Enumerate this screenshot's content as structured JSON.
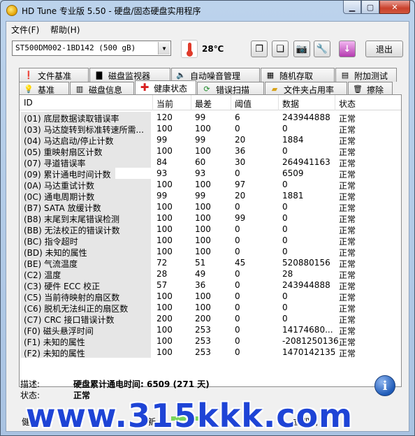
{
  "window": {
    "title": "HD Tune 专业版 5.50 - 硬盘/固态硬盘实用程序"
  },
  "menu": [
    {
      "label": "文件(F)"
    },
    {
      "label": "帮助(H)"
    }
  ],
  "toolbar": {
    "drive": "ST500DM002-1BD142 (500 gB)",
    "temperature": "28℃",
    "exit_label": "退出"
  },
  "tabs_top": [
    {
      "label": "文件基准",
      "icon": "file-benchmark-icon"
    },
    {
      "label": "磁盘监视器",
      "icon": "disk-monitor-icon"
    },
    {
      "label": "自动噪音管理",
      "icon": "speaker-icon"
    },
    {
      "label": "随机存取",
      "icon": "random-access-icon"
    },
    {
      "label": "附加测试",
      "icon": "extra-tests-icon"
    }
  ],
  "tabs_bottom": [
    {
      "label": "基准",
      "icon": "benchmark-icon"
    },
    {
      "label": "磁盘信息",
      "icon": "disk-info-icon"
    },
    {
      "label": "健康状态",
      "icon": "health-cross-icon",
      "active": true
    },
    {
      "label": "错误扫描",
      "icon": "error-scan-icon"
    },
    {
      "label": "文件夹占用率",
      "icon": "folder-icon"
    },
    {
      "label": "擦除",
      "icon": "trash-icon"
    }
  ],
  "table": {
    "headers": [
      "ID",
      "当前",
      "最差",
      "阈值",
      "数据",
      "状态"
    ],
    "rows": [
      {
        "id": "(01) 底层数据读取错误率",
        "current": "120",
        "worst": "99",
        "threshold": "6",
        "data": "243944888",
        "status": "正常"
      },
      {
        "id": "(03) 马达旋转到标准转速所需...",
        "current": "100",
        "worst": "100",
        "threshold": "0",
        "data": "0",
        "status": "正常"
      },
      {
        "id": "(04) 马达启动/停止计数",
        "current": "99",
        "worst": "99",
        "threshold": "20",
        "data": "1884",
        "status": "正常"
      },
      {
        "id": "(05) 重映射扇区计数",
        "current": "100",
        "worst": "100",
        "threshold": "36",
        "data": "0",
        "status": "正常"
      },
      {
        "id": "(07) 寻道错误率",
        "current": "84",
        "worst": "60",
        "threshold": "30",
        "data": "264941163",
        "status": "正常"
      },
      {
        "id": "(09) 累计通电时间计数",
        "current": "93",
        "worst": "93",
        "threshold": "0",
        "data": "6509",
        "status": "正常",
        "selected": true
      },
      {
        "id": "(0A) 马达重试计数",
        "current": "100",
        "worst": "100",
        "threshold": "97",
        "data": "0",
        "status": "正常"
      },
      {
        "id": "(0C) 通电周期计数",
        "current": "99",
        "worst": "99",
        "threshold": "20",
        "data": "1881",
        "status": "正常"
      },
      {
        "id": "(B7) SATA 放缓计数",
        "current": "100",
        "worst": "100",
        "threshold": "0",
        "data": "0",
        "status": "正常"
      },
      {
        "id": "(B8) 末尾到末尾错误检测",
        "current": "100",
        "worst": "100",
        "threshold": "99",
        "data": "0",
        "status": "正常"
      },
      {
        "id": "(BB) 无法校正的错误计数",
        "current": "100",
        "worst": "100",
        "threshold": "0",
        "data": "0",
        "status": "正常"
      },
      {
        "id": "(BC) 指令超时",
        "current": "100",
        "worst": "100",
        "threshold": "0",
        "data": "0",
        "status": "正常"
      },
      {
        "id": "(BD) 未知的属性",
        "current": "100",
        "worst": "100",
        "threshold": "0",
        "data": "0",
        "status": "正常"
      },
      {
        "id": "(BE) 气流温度",
        "current": "72",
        "worst": "51",
        "threshold": "45",
        "data": "520880156",
        "status": "正常"
      },
      {
        "id": "(C2) 温度",
        "current": "28",
        "worst": "49",
        "threshold": "0",
        "data": "28",
        "status": "正常"
      },
      {
        "id": "(C3) 硬件 ECC 校正",
        "current": "57",
        "worst": "36",
        "threshold": "0",
        "data": "243944888",
        "status": "正常"
      },
      {
        "id": "(C5) 当前待映射的扇区数",
        "current": "100",
        "worst": "100",
        "threshold": "0",
        "data": "0",
        "status": "正常"
      },
      {
        "id": "(C6) 脱机无法纠正的扇区数",
        "current": "100",
        "worst": "100",
        "threshold": "0",
        "data": "0",
        "status": "正常"
      },
      {
        "id": "(C7) CRC 接口错误计数",
        "current": "200",
        "worst": "200",
        "threshold": "0",
        "data": "0",
        "status": "正常"
      },
      {
        "id": "(F0) 磁头悬浮时间",
        "current": "100",
        "worst": "253",
        "threshold": "0",
        "data": "14174680...",
        "status": "正常"
      },
      {
        "id": "(F1) 未知的属性",
        "current": "100",
        "worst": "253",
        "threshold": "0",
        "data": "-2081250136",
        "status": "正常"
      },
      {
        "id": "(F2) 未知的属性",
        "current": "100",
        "worst": "253",
        "threshold": "0",
        "data": "1470142135",
        "status": "正常"
      }
    ]
  },
  "details": {
    "desc_label": "描述:",
    "desc_value": "硬盘累计通电时间: 6509 (271 天)",
    "status_label": "状态:",
    "status_value": "正常"
  },
  "statusbar": {
    "left": "健",
    "middle": "刷新",
    "right": "立即刷"
  },
  "watermark": "www.315kkk.com",
  "colors": {
    "progress": "#7ad55b",
    "watermark": "#1e44d6"
  }
}
